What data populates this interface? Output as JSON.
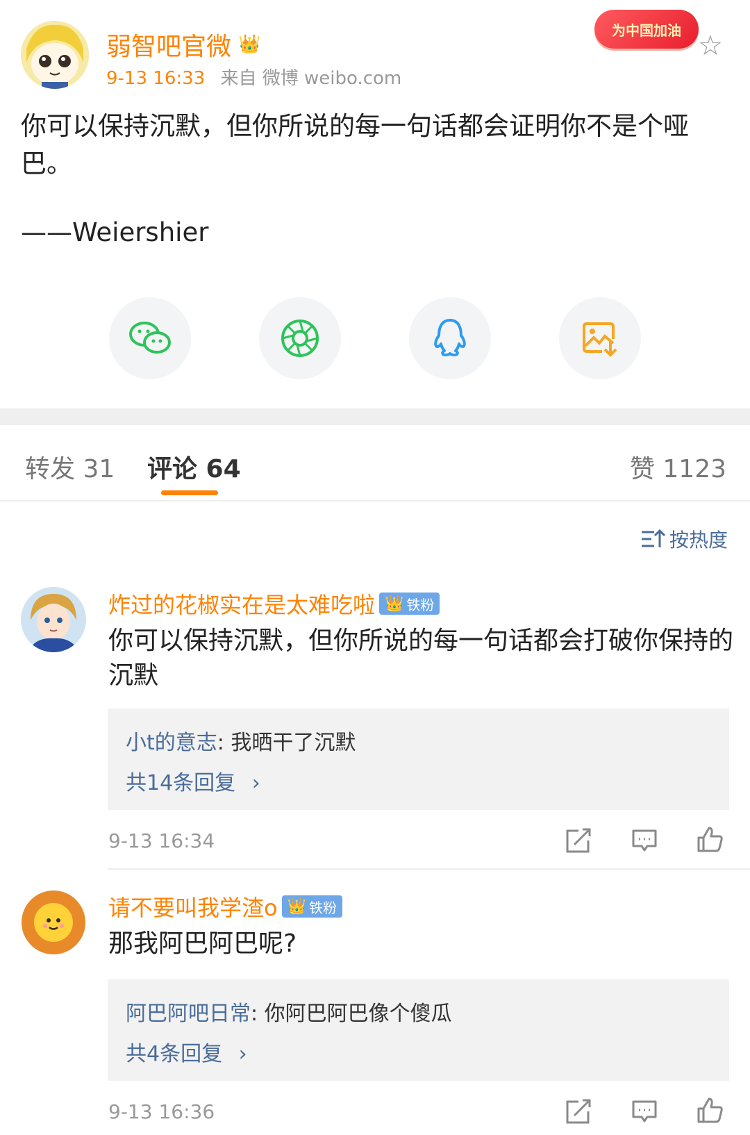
{
  "post": {
    "author": "弱智吧官微",
    "time": "9-13 16:33",
    "source": "来自 微博 weibo.com",
    "promo_badge": "为中国加油",
    "text": "你可以保持沉默，但你所说的每一句话都会证明你不是个哑巴。",
    "signature": "——Weiershier"
  },
  "share": {
    "icons": [
      "wechat-icon",
      "moments-icon",
      "qq-icon",
      "save-image-icon"
    ]
  },
  "tabs": {
    "repost": "转发 31",
    "comments": "评论 64",
    "likes": "赞 1123"
  },
  "sort": {
    "label": "按热度"
  },
  "comments": [
    {
      "user": "炸过的花椒实在是太难吃啦",
      "badge": "铁粉",
      "text": "你可以保持沉默，但你所说的每一句话都会打破你保持的沉默",
      "reply_user": "小t的意志",
      "reply_text": ": 我晒干了沉默",
      "reply_count": "共14条回复",
      "time": "9-13 16:34"
    },
    {
      "user": "请不要叫我学渣o",
      "badge": "铁粉",
      "text": "那我阿巴阿巴呢?",
      "reply_user": "阿巴阿吧日常",
      "reply_text": ": 你阿巴阿巴像个傻瓜",
      "reply_count": "共4条回复",
      "time": "9-13 16:36"
    }
  ],
  "colors": {
    "accent": "#ff8200",
    "link": "#4a6c9a",
    "fan_badge": "#6da7e8"
  }
}
